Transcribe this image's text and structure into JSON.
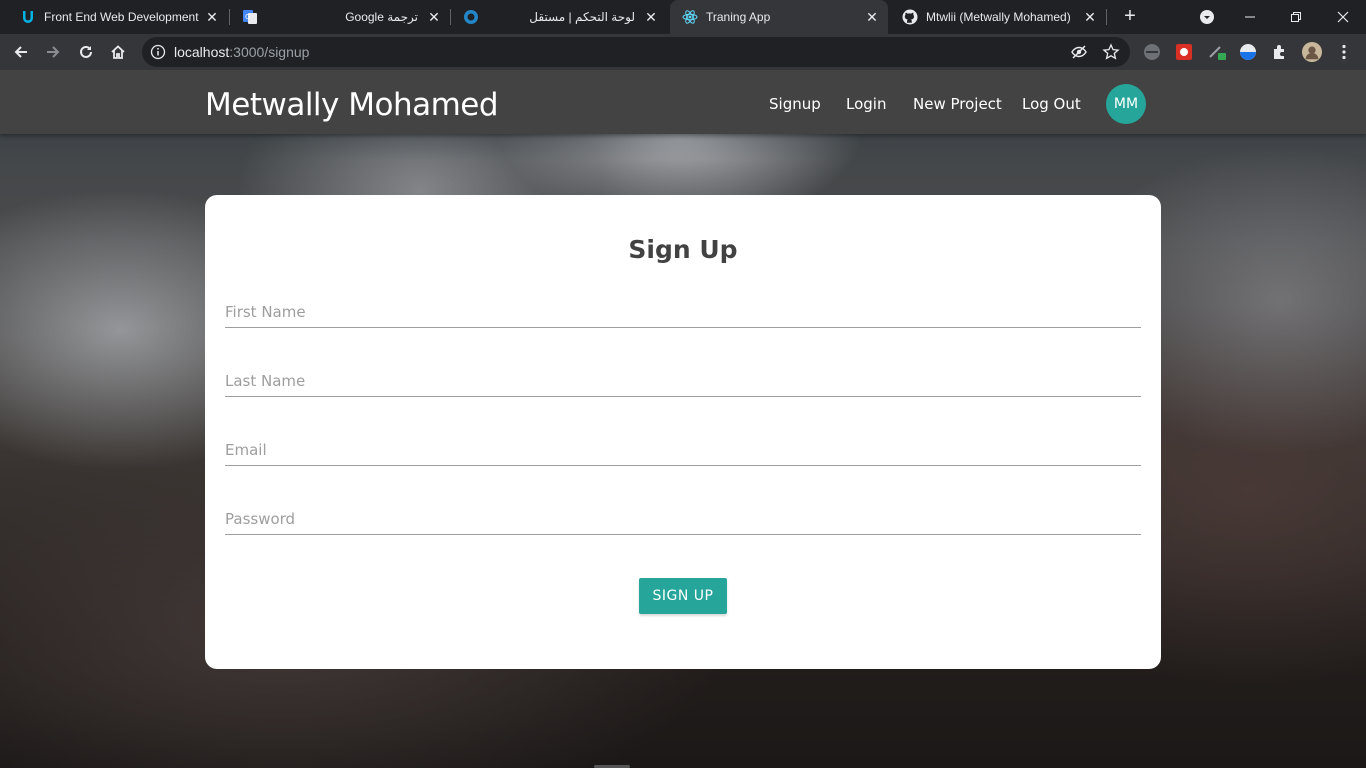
{
  "browser": {
    "tabs": [
      {
        "title": "Front End Web Development",
        "icon": "udacity-icon",
        "active": false,
        "rtl": false
      },
      {
        "title": "",
        "icon": "google-translate-icon",
        "active": false,
        "rtl": false
      },
      {
        "title": "ترجمة Google",
        "icon": "",
        "active": false,
        "rtl": true
      },
      {
        "title": "لوحة التحكم | مستقل",
        "icon": "mostaql-icon",
        "active": false,
        "rtl": true
      },
      {
        "title": "Traning App",
        "icon": "react-icon",
        "active": true,
        "rtl": false
      },
      {
        "title": "Mtwlii (Metwally Mohamed)",
        "icon": "github-icon",
        "active": false,
        "rtl": false
      }
    ],
    "url_host": "localhost",
    "url_path": ":3000/signup"
  },
  "app": {
    "brand": "Metwally Mohamed",
    "nav": {
      "signup": "Signup",
      "login": "Login",
      "new_project": "New Project",
      "logout": "Log Out"
    },
    "avatar_initials": "MM"
  },
  "form": {
    "title": "Sign Up",
    "first_name_placeholder": "First Name",
    "last_name_placeholder": "Last Name",
    "email_placeholder": "Email",
    "password_placeholder": "Password",
    "submit_label": "SIGN UP"
  },
  "colors": {
    "accent": "#26a69a",
    "navbar": "#434343",
    "card": "#ffffff"
  }
}
